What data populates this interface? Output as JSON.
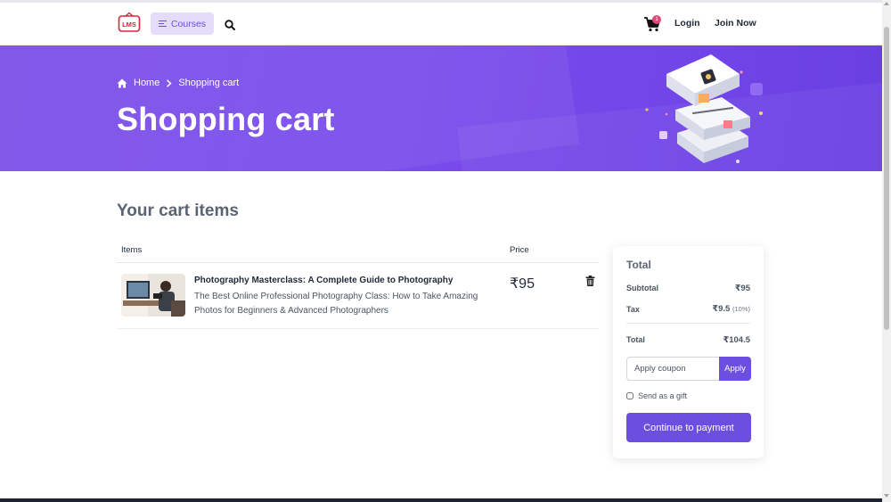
{
  "header": {
    "logo_text": "LMS",
    "courses_label": "Courses",
    "cart_count": "1",
    "login_label": "Login",
    "join_label": "Join Now"
  },
  "hero": {
    "breadcrumb": {
      "home": "Home",
      "current": "Shopping cart"
    },
    "title": "Shopping cart"
  },
  "cart": {
    "section_title": "Your cart items",
    "columns": {
      "items": "Items",
      "price": "Price"
    },
    "items": [
      {
        "title": "Photography Masterclass: A Complete Guide to Photography",
        "description": "The Best Online Professional Photography Class: How to Take Amazing Photos for Beginners & Advanced Photographers",
        "price": "₹95"
      }
    ]
  },
  "totals": {
    "title": "Total",
    "subtotal_label": "Subtotal",
    "subtotal_value": "₹95",
    "tax_label": "Tax",
    "tax_value": "₹9.5",
    "tax_percent": "(10%)",
    "total_label": "Total",
    "total_value": "₹104.5",
    "coupon_placeholder": "Apply coupon",
    "apply_label": "Apply",
    "gift_label": "Send as a gift",
    "gift_checked": false,
    "pay_label": "Continue to payment"
  },
  "colors": {
    "accent": "#6d4fe0",
    "hero_bg": "#7a4cec",
    "badge": "#e0457b",
    "logo_red": "#d6273f"
  }
}
